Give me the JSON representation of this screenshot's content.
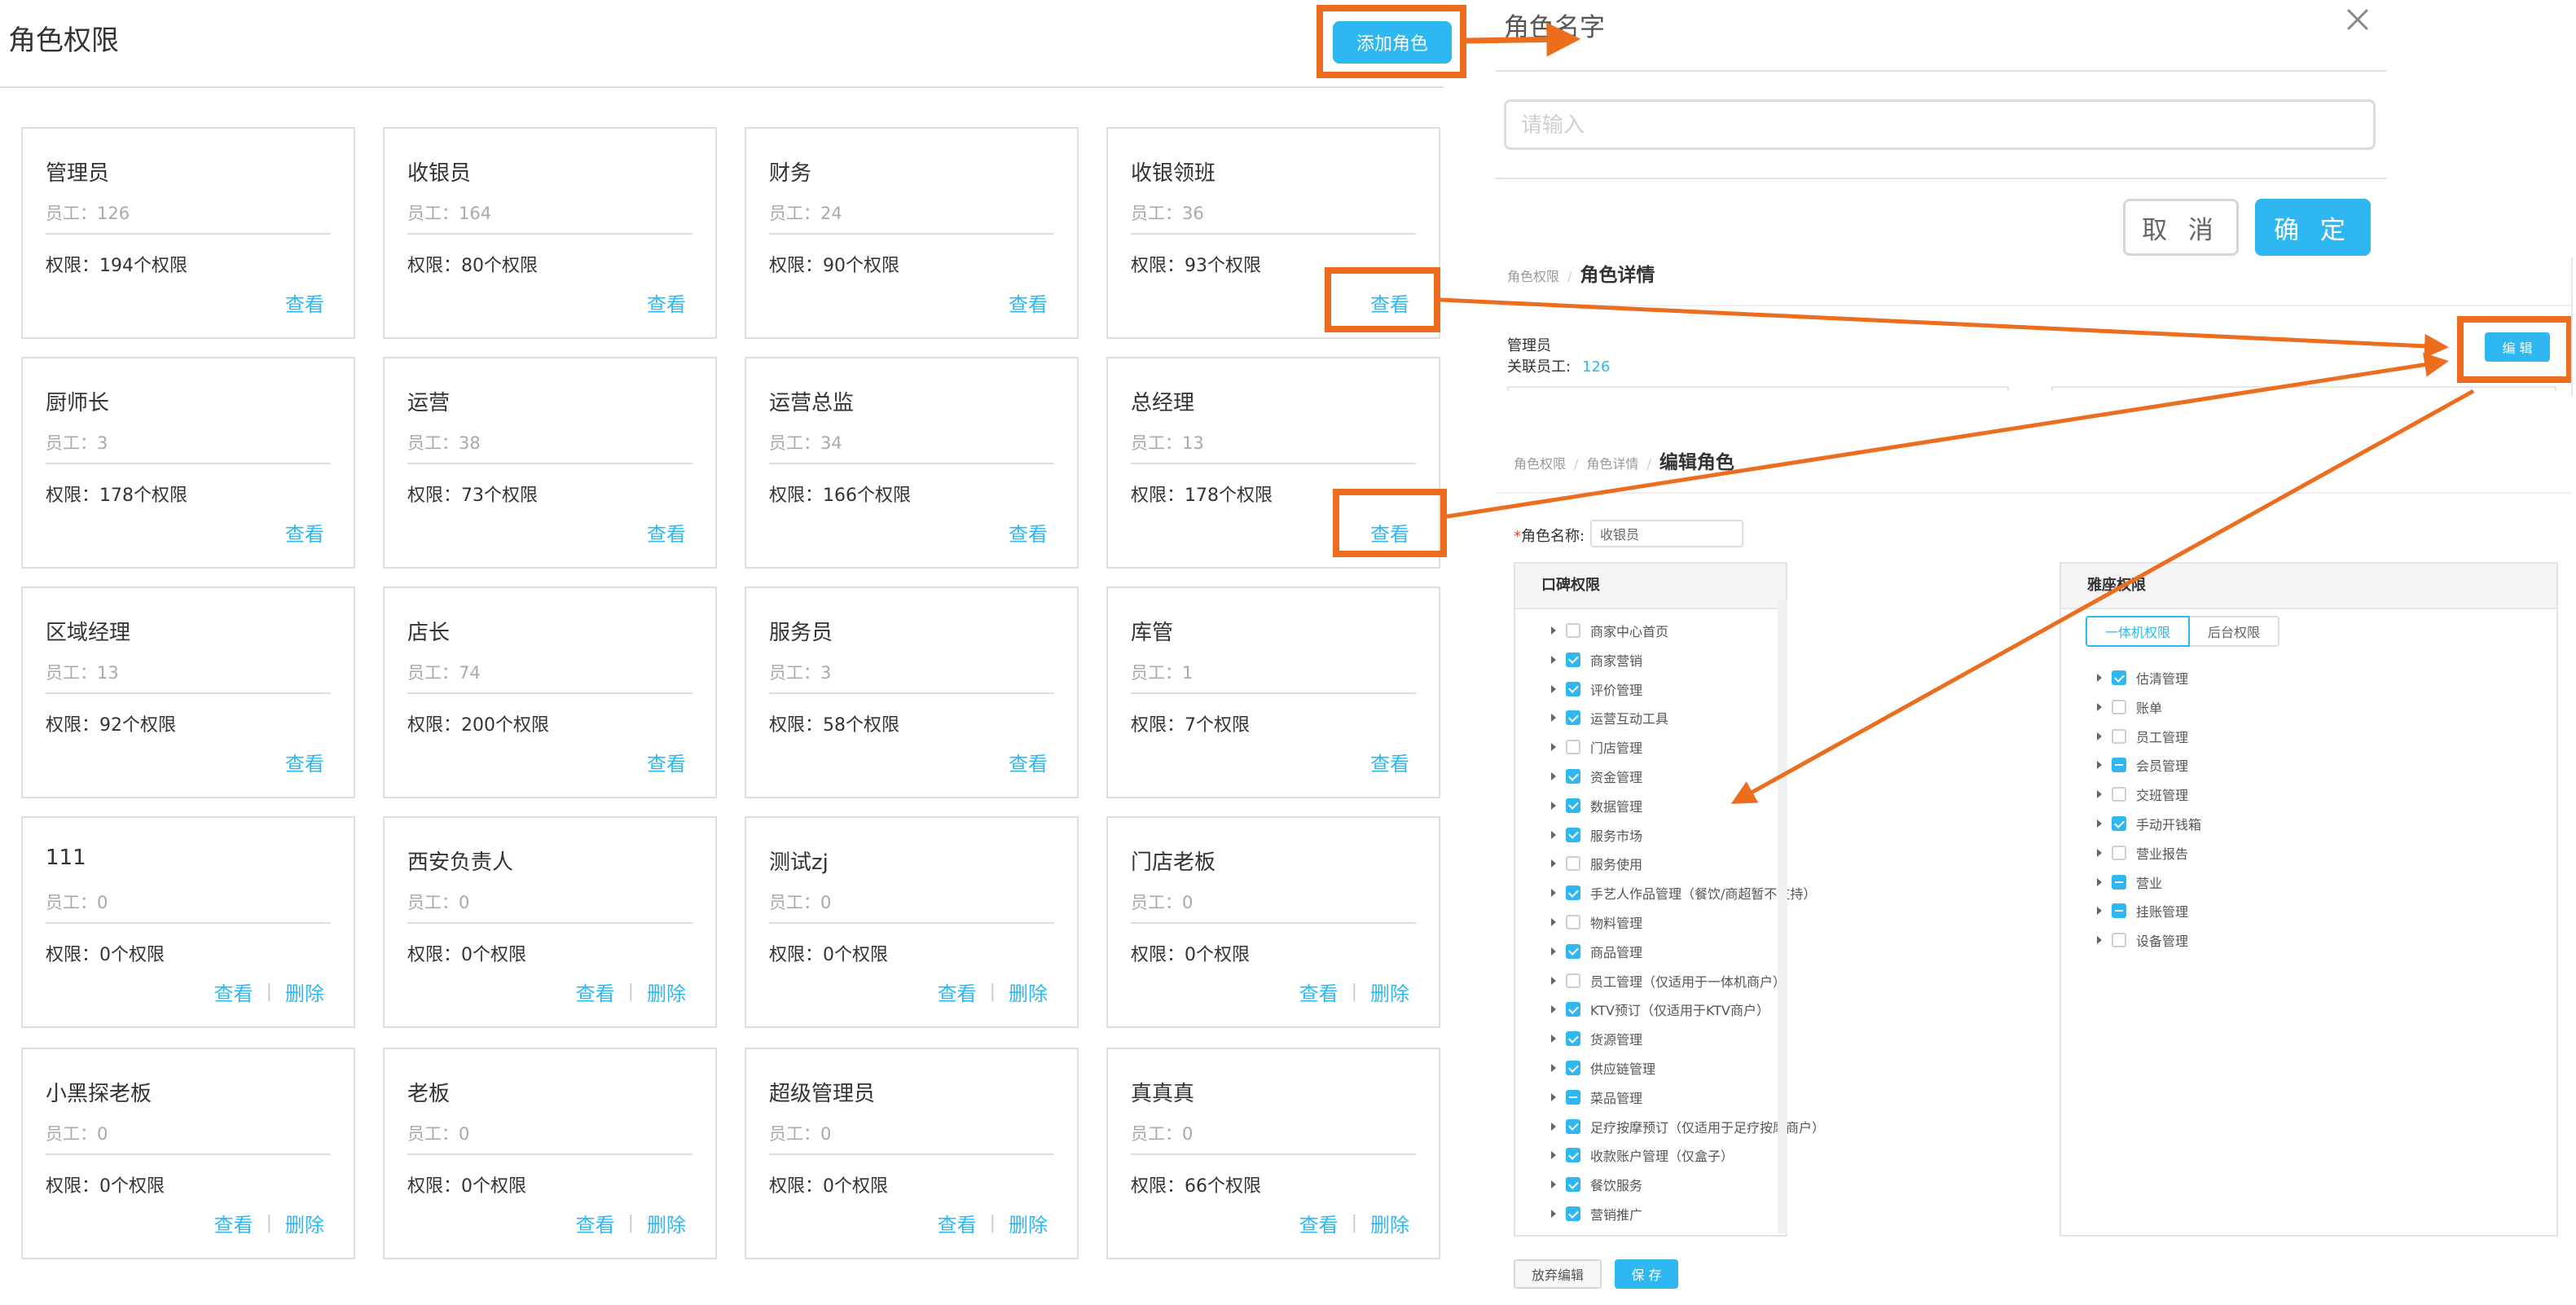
{
  "colors": {
    "accent": "#2eb7f0",
    "annotation_orange": "#ed6d1f",
    "danger_star": "#e64a3b"
  },
  "role_list": {
    "title": "角色权限",
    "add_button": "添加角色",
    "view_label": "查看",
    "delete_label": "删除",
    "cards": [
      {
        "name": "管理员",
        "staff": "员工：126",
        "perms": "权限：194个权限",
        "deletable": false
      },
      {
        "name": "收银员",
        "staff": "员工：164",
        "perms": "权限：80个权限",
        "deletable": false
      },
      {
        "name": "财务",
        "staff": "员工：24",
        "perms": "权限：90个权限",
        "deletable": false
      },
      {
        "name": "收银领班",
        "staff": "员工：36",
        "perms": "权限：93个权限",
        "deletable": false
      },
      {
        "name": "厨师长",
        "staff": "员工：3",
        "perms": "权限：178个权限",
        "deletable": false
      },
      {
        "name": "运营",
        "staff": "员工：38",
        "perms": "权限：73个权限",
        "deletable": false
      },
      {
        "name": "运营总监",
        "staff": "员工：34",
        "perms": "权限：166个权限",
        "deletable": false
      },
      {
        "name": "总经理",
        "staff": "员工：13",
        "perms": "权限：178个权限",
        "deletable": false
      },
      {
        "name": "区域经理",
        "staff": "员工：13",
        "perms": "权限：92个权限",
        "deletable": false
      },
      {
        "name": "店长",
        "staff": "员工：74",
        "perms": "权限：200个权限",
        "deletable": false
      },
      {
        "name": "服务员",
        "staff": "员工：3",
        "perms": "权限：58个权限",
        "deletable": false
      },
      {
        "name": "库管",
        "staff": "员工：1",
        "perms": "权限：7个权限",
        "deletable": false
      },
      {
        "name": "111",
        "staff": "员工：0",
        "perms": "权限：0个权限",
        "deletable": true
      },
      {
        "name": "西安负责人",
        "staff": "员工：0",
        "perms": "权限：0个权限",
        "deletable": true
      },
      {
        "name": "测试zj",
        "staff": "员工：0",
        "perms": "权限：0个权限",
        "deletable": true
      },
      {
        "name": "门店老板",
        "staff": "员工：0",
        "perms": "权限：0个权限",
        "deletable": true
      },
      {
        "name": "小黑探老板",
        "staff": "员工：0",
        "perms": "权限：0个权限",
        "deletable": true
      },
      {
        "name": "老板",
        "staff": "员工：0",
        "perms": "权限：0个权限",
        "deletable": true
      },
      {
        "name": "超级管理员",
        "staff": "员工：0",
        "perms": "权限：0个权限",
        "deletable": true
      },
      {
        "name": "真真真",
        "staff": "员工：0",
        "perms": "权限：66个权限",
        "deletable": true
      }
    ]
  },
  "add_dialog": {
    "title": "角色名字",
    "input_placeholder": "请输入",
    "cancel": "取 消",
    "confirm": "确 定",
    "close_icon": "close-icon"
  },
  "role_detail": {
    "crumb_root": "角色权限",
    "crumb_current": "角色详情",
    "role_name": "管理员",
    "staff_label": "关联员工:",
    "staff_count": "126",
    "edit_button": "编 辑"
  },
  "edit_role": {
    "crumb_root": "角色权限",
    "crumb_mid": "角色详情",
    "crumb_current": "编辑角色",
    "name_label_star": "*",
    "name_label": "角色名称:",
    "name_value": "收银员",
    "koubei": {
      "title": "口碑权限",
      "items": [
        {
          "label": "商家中心首页",
          "state": "unchecked"
        },
        {
          "label": "商家营销",
          "state": "checked"
        },
        {
          "label": "评价管理",
          "state": "checked"
        },
        {
          "label": "运营互动工具",
          "state": "checked"
        },
        {
          "label": "门店管理",
          "state": "unchecked"
        },
        {
          "label": "资金管理",
          "state": "checked"
        },
        {
          "label": "数据管理",
          "state": "checked"
        },
        {
          "label": "服务市场",
          "state": "checked"
        },
        {
          "label": "服务使用",
          "state": "unchecked"
        },
        {
          "label": "手艺人作品管理（餐饮/商超暂不支持）",
          "state": "checked"
        },
        {
          "label": "物料管理",
          "state": "unchecked"
        },
        {
          "label": "商品管理",
          "state": "checked"
        },
        {
          "label": "员工管理（仅适用于一体机商户）",
          "state": "unchecked"
        },
        {
          "label": "KTV预订（仅适用于KTV商户）",
          "state": "checked"
        },
        {
          "label": "货源管理",
          "state": "checked"
        },
        {
          "label": "供应链管理",
          "state": "checked"
        },
        {
          "label": "菜品管理",
          "state": "partial"
        },
        {
          "label": "足疗按摩预订（仅适用于足疗按摩商户）",
          "state": "checked"
        },
        {
          "label": "收款账户管理（仅盒子）",
          "state": "checked"
        },
        {
          "label": "餐饮服务",
          "state": "checked"
        },
        {
          "label": "营销推广",
          "state": "checked"
        }
      ]
    },
    "yazuo": {
      "title": "雅座权限",
      "tab_active": "一体机权限",
      "tab_inactive": "后台权限",
      "items": [
        {
          "label": "估清管理",
          "state": "checked"
        },
        {
          "label": "账单",
          "state": "unchecked"
        },
        {
          "label": "员工管理",
          "state": "unchecked"
        },
        {
          "label": "会员管理",
          "state": "partial"
        },
        {
          "label": "交班管理",
          "state": "unchecked"
        },
        {
          "label": "手动开钱箱",
          "state": "checked"
        },
        {
          "label": "营业报告",
          "state": "unchecked"
        },
        {
          "label": "营业",
          "state": "partial"
        },
        {
          "label": "挂账管理",
          "state": "partial"
        },
        {
          "label": "设备管理",
          "state": "unchecked"
        }
      ]
    },
    "discard_button": "放弃编辑",
    "save_button": "保 存"
  }
}
